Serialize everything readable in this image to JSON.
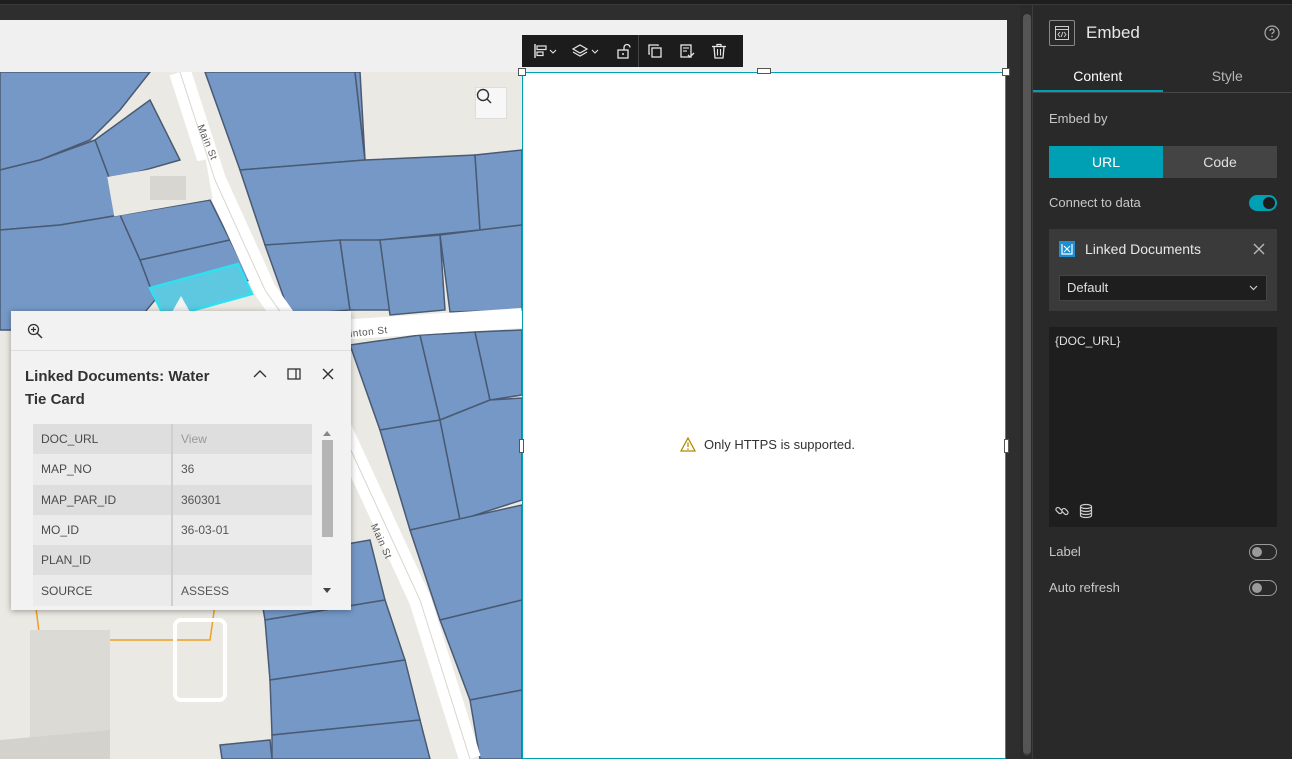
{
  "map": {
    "street_labels": [
      "Main St",
      "inton St",
      "Main St"
    ]
  },
  "popup": {
    "title": "Linked Documents: Water Tie Card",
    "rows": [
      {
        "key": "DOC_URL",
        "value": "View"
      },
      {
        "key": "MAP_NO",
        "value": "36"
      },
      {
        "key": "MAP_PAR_ID",
        "value": "360301"
      },
      {
        "key": "MO_ID",
        "value": "36-03-01"
      },
      {
        "key": "PLAN_ID",
        "value": ""
      },
      {
        "key": "SOURCE",
        "value": "ASSESS"
      }
    ]
  },
  "embed_frame": {
    "warning": "Only HTTPS is supported."
  },
  "panel": {
    "title": "Embed",
    "tabs": [
      {
        "label": "Content",
        "active": true
      },
      {
        "label": "Style",
        "active": false
      }
    ],
    "embed_by_label": "Embed by",
    "embed_by_options": [
      {
        "label": "URL",
        "selected": true
      },
      {
        "label": "Code",
        "selected": false
      }
    ],
    "connect_to_data_label": "Connect to data",
    "connect_to_data_on": true,
    "data_source": {
      "name": "Linked Documents",
      "view": "Default"
    },
    "url_expression": "{DOC_URL}",
    "label_toggle": {
      "label": "Label",
      "on": false
    },
    "auto_refresh_toggle": {
      "label": "Auto refresh",
      "on": false
    }
  },
  "colors": {
    "accent": "#00a0b4",
    "parcel_fill": "#7598c6",
    "parcel_stroke": "#4a5a72",
    "selected_parcel": "#5ec8e0",
    "panel_bg": "#292929"
  }
}
